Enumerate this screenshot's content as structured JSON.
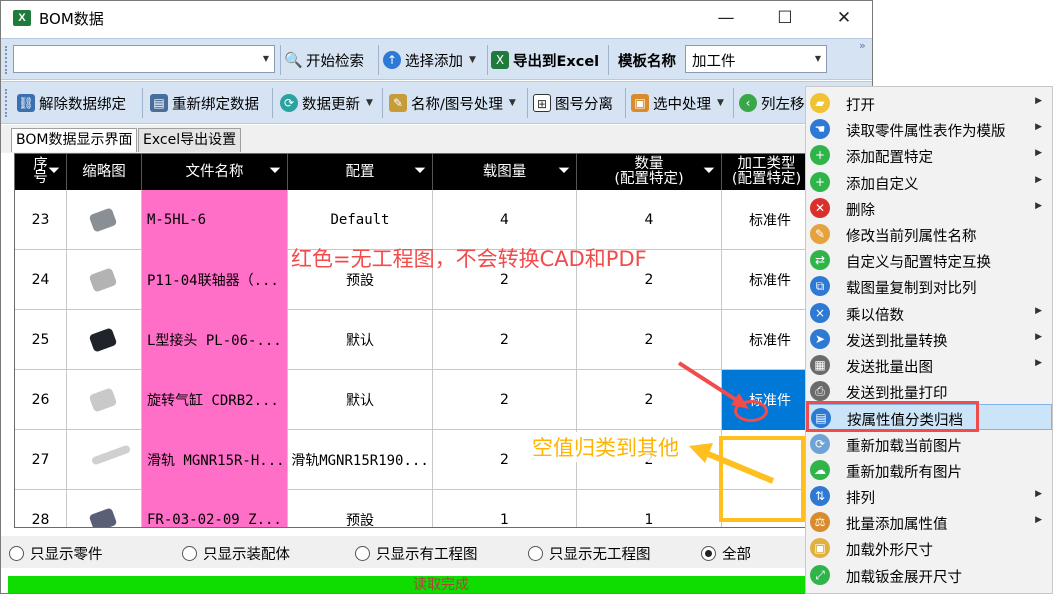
{
  "window": {
    "title": "BOM数据",
    "icon": "excel-icon"
  },
  "toolbar1": {
    "search_value": "",
    "start_search": "开始检索",
    "select_add": "选择添加",
    "export_excel": "导出到Excel",
    "template_label": "模板名称",
    "template_value": "加工件"
  },
  "toolbar2": {
    "unbind": "解除数据绑定",
    "rebind": "重新绑定数据",
    "update": "数据更新",
    "name_process": "名称/图号处理",
    "split": "图号分离",
    "select_process": "选中处理",
    "col_move": "列左移"
  },
  "tabs": [
    "BOM数据显示界面",
    "Excel导出设置"
  ],
  "grid": {
    "headers": {
      "seq": "序号",
      "thumb": "缩略图",
      "filename": "文件名称",
      "config": "配置",
      "qty": "载图量",
      "count_l1": "数量",
      "count_l2": "(配置特定)",
      "type_l1": "加工类型",
      "type_l2": "(配置特定)"
    },
    "rows": [
      {
        "seq": "23",
        "filename": "M-5HL-6",
        "config": "Default",
        "qty": "4",
        "count": "4",
        "type": "标准件"
      },
      {
        "seq": "24",
        "filename": "P11-04联轴器（...",
        "config": "预設",
        "qty": "2",
        "count": "2",
        "type": "标准件"
      },
      {
        "seq": "25",
        "filename": "L型接头 PL-06-...",
        "config": "默认",
        "qty": "2",
        "count": "2",
        "type": "标准件"
      },
      {
        "seq": "26",
        "filename": "旋转气缸 CDRB2...",
        "config": "默认",
        "qty": "2",
        "count": "2",
        "type": "标准件"
      },
      {
        "seq": "27",
        "filename": "滑轨 MGNR15R-H...",
        "config": "滑轨MGNR15R190...",
        "qty": "2",
        "count": "2",
        "type": ""
      },
      {
        "seq": "28",
        "filename": "FR-03-02-09 Z...",
        "config": "预設",
        "qty": "1",
        "count": "1",
        "type": ""
      }
    ]
  },
  "annotations": {
    "red_note": "红色=无工程图，不会转换CAD和PDF",
    "yellow_note": "空值归类到其他",
    "red_color": "#f24b4b",
    "yellow_color": "#ffb400",
    "pink_cell": "#ff6ec7",
    "selected_cell": "#0078d7"
  },
  "filters": {
    "parts_only": "只显示零件",
    "assemblies_only": "只显示装配体",
    "has_drawing": "只显示有工程图",
    "no_drawing": "只显示无工程图",
    "all": "全部",
    "selected": "all"
  },
  "status": {
    "text": "读取完成",
    "color": "#0fdc00"
  },
  "menu": {
    "items": [
      {
        "label": "打开",
        "icon": "folder-icon",
        "sub": true
      },
      {
        "label": "读取零件属性表作为模版",
        "icon": "hand-icon",
        "sub": true
      },
      {
        "label": "添加配置特定",
        "icon": "plus-icon",
        "sub": true
      },
      {
        "label": "添加自定义",
        "icon": "plus-icon",
        "sub": true
      },
      {
        "label": "删除",
        "icon": "delete-x-icon",
        "sub": true
      },
      {
        "label": "修改当前列属性名称",
        "icon": "edit-icon",
        "sub": false
      },
      {
        "label": "自定义与配置特定互换",
        "icon": "swap-icon",
        "sub": false
      },
      {
        "label": "载图量复制到对比列",
        "icon": "copy-icon",
        "sub": false
      },
      {
        "label": "乘以倍数",
        "icon": "multiply-icon",
        "sub": true
      },
      {
        "label": "发送到批量转换",
        "icon": "send-icon",
        "sub": true
      },
      {
        "label": "发送批量出图",
        "icon": "drawing-icon",
        "sub": true
      },
      {
        "label": "发送到批量打印",
        "icon": "printer-icon",
        "sub": false
      },
      {
        "label": "按属性值分类归档",
        "icon": "archive-icon",
        "sub": false,
        "highlighted": true
      },
      {
        "label": "重新加载当前图片",
        "icon": "reload-icon",
        "sub": false
      },
      {
        "label": "重新加载所有图片",
        "icon": "cloud-icon",
        "sub": false
      },
      {
        "label": "排列",
        "icon": "sort-icon",
        "sub": true
      },
      {
        "label": "批量添加属性值",
        "icon": "scale-icon",
        "sub": true
      },
      {
        "label": "加载外形尺寸",
        "icon": "box-icon",
        "sub": false
      },
      {
        "label": "加载钣金展开尺寸",
        "icon": "expand-icon",
        "sub": false
      }
    ]
  }
}
